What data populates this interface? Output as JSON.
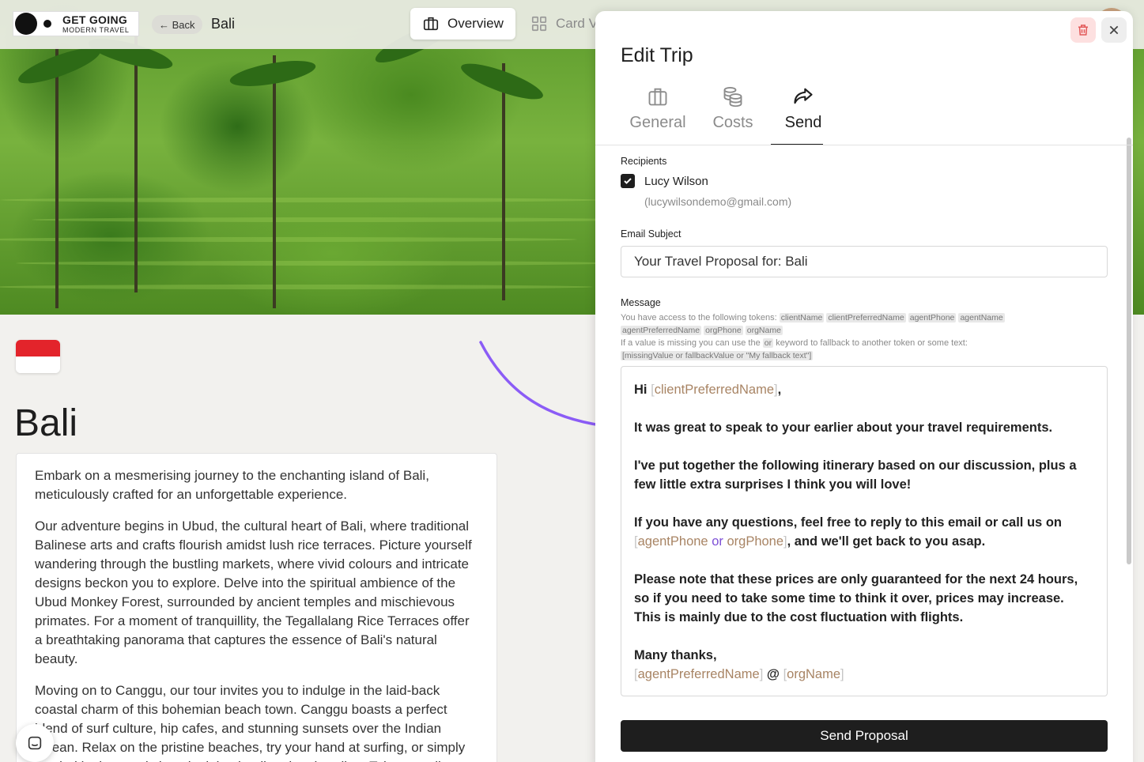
{
  "app": {
    "logo_line1": "GET GOING",
    "logo_line2": "MODERN TRAVEL",
    "back_label": "← Back",
    "trip_name": "Bali",
    "view_tabs": [
      {
        "label": "Overview",
        "active": true
      },
      {
        "label": "Card V",
        "active": false
      }
    ]
  },
  "destination": {
    "title": "Bali",
    "flag_colors": [
      "#e3242b",
      "#ffffff"
    ],
    "paragraphs": [
      "Embark on a mesmerising journey to the enchanting island of Bali, meticulously crafted for an unforgettable experience.",
      "Our adventure begins in Ubud, the cultural heart of Bali, where traditional Balinese arts and crafts flourish amidst lush rice terraces. Picture yourself wandering through the bustling markets, where vivid colours and intricate designs beckon you to explore. Delve into the spiritual ambience of the Ubud Monkey Forest, surrounded by ancient temples and mischievous primates. For a moment of tranquillity, the Tegallalang Rice Terraces offer a breathtaking panorama that captures the essence of Bali's natural beauty.",
      "Moving on to Canggu, our tour invites you to indulge in the laid-back coastal charm of this bohemian beach town. Canggu boasts a perfect blend of surf culture, hip cafes, and stunning sunsets over the Indian Ocean. Relax on the pristine beaches, try your hand at surfing, or simply unwind in the trendy beach clubs that line the shoreline. Take a stroll"
    ]
  },
  "panel": {
    "title": "Edit Trip",
    "tabs": [
      {
        "label": "General",
        "icon": "briefcase-icon",
        "active": false
      },
      {
        "label": "Costs",
        "icon": "coins-icon",
        "active": false
      },
      {
        "label": "Send",
        "icon": "share-arrow-icon",
        "active": true
      }
    ],
    "recipients_label": "Recipients",
    "recipient": {
      "name": "Lucy Wilson",
      "email": "(lucywilsondemo@gmail.com)",
      "checked": true
    },
    "subject_label": "Email Subject",
    "subject_value": "Your Travel Proposal for: Bali",
    "message_label": "Message",
    "hint_tokens_intro": "You have access to the following tokens:",
    "tokens": [
      "clientName",
      "clientPreferredName",
      "agentPhone",
      "agentName",
      "agentPreferredName",
      "orgPhone",
      "orgName"
    ],
    "hint_fallback_a": "If a value is missing you can use the",
    "hint_fallback_or": "or",
    "hint_fallback_b": "keyword to fallback to another token or some text:",
    "hint_example": "[missingValue or fallbackValue or \"My fallback text\"]",
    "message": {
      "greeting": "Hi",
      "greeting_token": "clientPreferredName",
      "p1": "It was great to speak to your earlier about your travel requirements.",
      "p2": "I've put together the following itinerary based on our discussion, plus a few little extra surprises I think you will love!",
      "p3": "If you have any questions, feel free to reply to this email or call us on",
      "p3_token_a": "agentPhone",
      "p3_or": "or",
      "p3_token_b": "orgPhone",
      "p3_end": ", and we'll get back to you asap.",
      "p4": "Please note that these prices are only guaranteed for the next 24 hours, so if you need to take some time to think it over, prices may increase. This is mainly due to the cost fluctuation with flights.",
      "signoff": "Many thanks,",
      "sig_token_a": "agentPreferredName",
      "sig_at": "@",
      "sig_token_b": "orgName"
    },
    "send_label": "Send Proposal",
    "accent": "#7d4fd6",
    "token_color": "#a88464"
  }
}
